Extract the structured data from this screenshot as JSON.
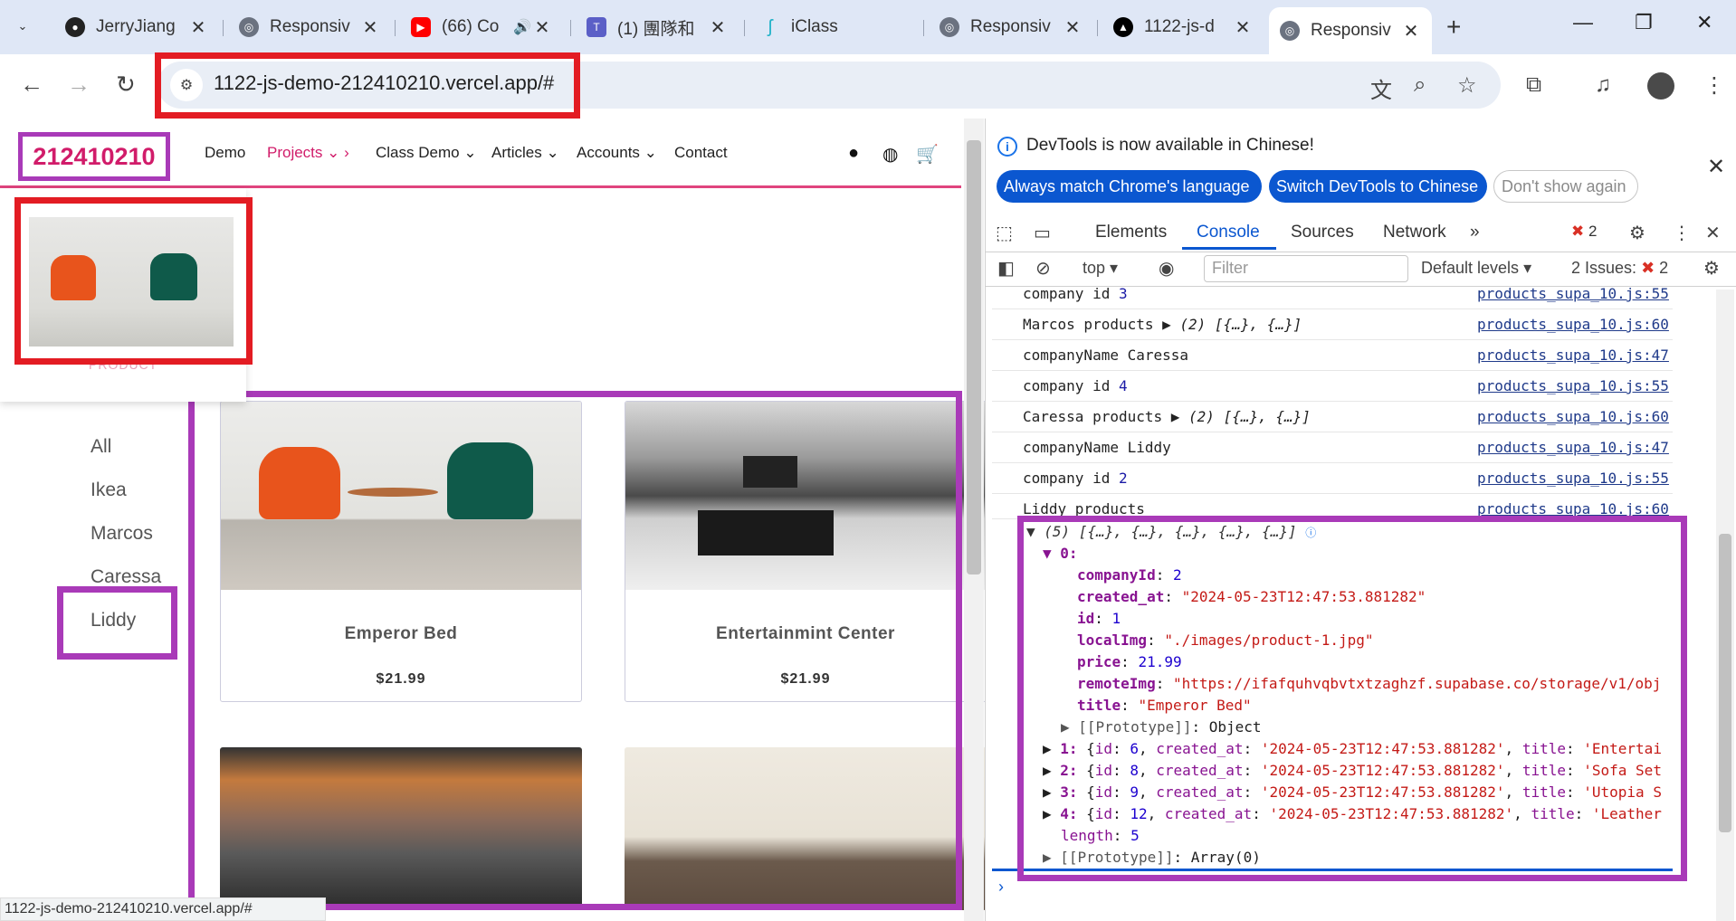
{
  "browser": {
    "tabs": [
      {
        "title": "JerryJiang",
        "icon": "github-icon"
      },
      {
        "title": "Responsiv",
        "icon": "globe-icon"
      },
      {
        "title": "(66) Co",
        "icon": "youtube-icon"
      },
      {
        "title": "(1) 團隊和",
        "icon": "teams-icon"
      },
      {
        "title": "iClass",
        "icon": "iclass-icon"
      },
      {
        "title": "Responsiv",
        "icon": "globe-icon"
      },
      {
        "title": "1122-js-d",
        "icon": "vercel-icon"
      },
      {
        "title": "Responsiv",
        "icon": "globe-icon"
      }
    ],
    "url": "1122-js-demo-212410210.vercel.app/#",
    "status_url": "1122-js-demo-212410210.vercel.app/#"
  },
  "site": {
    "brand": "212410210",
    "nav": {
      "demo": "Demo",
      "projects": "Projects",
      "class_demo": "Class Demo",
      "articles": "Articles",
      "accounts": "Accounts",
      "contact": "Contact"
    },
    "dropdown_item": "PRODUCT",
    "categories": [
      "All",
      "Ikea",
      "Marcos",
      "Caressa",
      "Liddy"
    ],
    "products": [
      {
        "title": "Emperor Bed",
        "price": "$21.99"
      },
      {
        "title": "Entertainmint Center",
        "price": "$21.99"
      }
    ]
  },
  "devtools": {
    "banner_text": "DevTools is now available in Chinese!",
    "btn_match": "Always match Chrome's language",
    "btn_switch": "Switch DevTools to Chinese",
    "btn_dismiss": "Don't show again",
    "tabs": {
      "elements": "Elements",
      "console": "Console",
      "sources": "Sources",
      "network": "Network"
    },
    "error_count": "2",
    "context": "top",
    "filter_placeholder": "Filter",
    "levels": "Default levels",
    "issues_label": "2 Issues:",
    "issues_count": "2",
    "log": [
      {
        "text": "company id ",
        "num": "3",
        "src": "products_supa_10.js:55"
      },
      {
        "text": "Marcos products ",
        "arr": "▶ (2) [{…}, {…}]",
        "src": "products_supa_10.js:60"
      },
      {
        "text": "companyName Caressa",
        "src": "products_supa_10.js:47"
      },
      {
        "text": "company id ",
        "num": "4",
        "src": "products_supa_10.js:55"
      },
      {
        "text": "Caressa products ",
        "arr": "▶ (2) [{…}, {…}]",
        "src": "products_supa_10.js:60"
      },
      {
        "text": "companyName Liddy",
        "src": "products_supa_10.js:47"
      },
      {
        "text": "company id ",
        "num": "2",
        "src": "products_supa_10.js:55"
      },
      {
        "text": "Liddy products",
        "src": "products_supa_10.js:60"
      }
    ],
    "tree": {
      "header": "▼ (5) [{…}, {…}, {…}, {…}, {…}]",
      "item0": "▼ 0:",
      "companyId": "2",
      "created_at": "\"2024-05-23T12:47:53.881282\"",
      "id": "1",
      "localImg": "\"./images/product-1.jpg\"",
      "price": "21.99",
      "remoteImg": "\"https://ifafquhvqbvtxtzaghzf.supabase.co/storage/v1/obj",
      "title": "\"Emperor Bed\"",
      "proto_obj": "Object",
      "rows": [
        {
          "idx": "1:",
          "id": "6",
          "created": "'2024-05-23T12:47:53.881282'",
          "title": "'Entertai"
        },
        {
          "idx": "2:",
          "id": "8",
          "created": "'2024-05-23T12:47:53.881282'",
          "title": "'Sofa Set"
        },
        {
          "idx": "3:",
          "id": "9",
          "created": "'2024-05-23T12:47:53.881282'",
          "title": "'Utopia S"
        },
        {
          "idx": "4:",
          "id": "12",
          "created": "'2024-05-23T12:47:53.881282'",
          "title": "'Leather"
        }
      ],
      "length": "5",
      "proto_arr": "Array(0)"
    }
  },
  "colors": {
    "annotation_red": "#e31c23",
    "annotation_purple": "#a93ab8",
    "brand_pink": "#d11c6a",
    "devtools_blue": "#0b57d0"
  }
}
